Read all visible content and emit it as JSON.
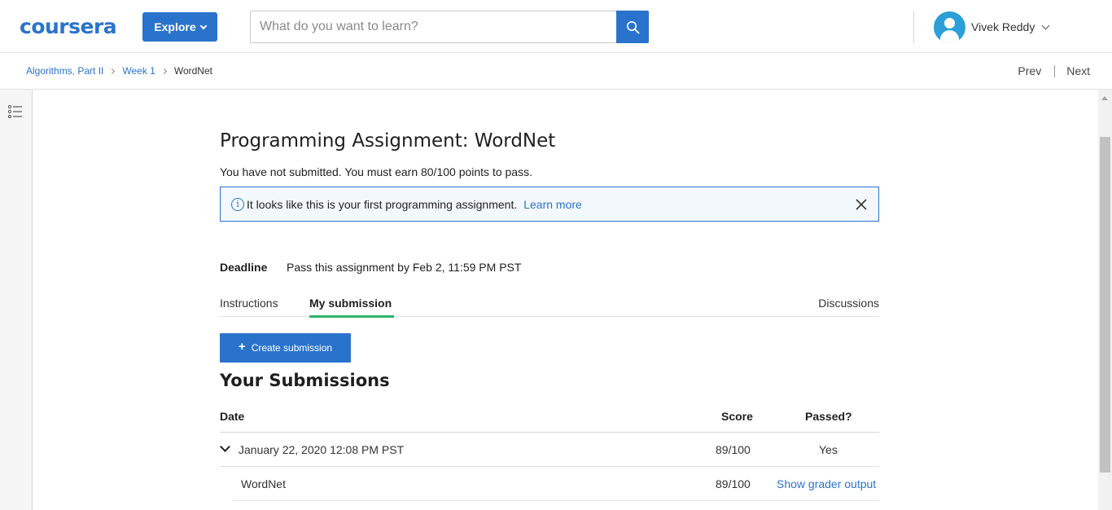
{
  "header": {
    "logo_text": "coursera",
    "explore_label": "Explore",
    "search_placeholder": "What do you want to learn?",
    "user_name": "Vivek Reddy"
  },
  "breadcrumb": {
    "items": [
      "Algorithms, Part II",
      "Week 1"
    ],
    "current": "WordNet",
    "prev_label": "Prev",
    "next_label": "Next"
  },
  "assignment": {
    "title": "Programming Assignment: WordNet",
    "status": "You have not submitted. You must earn 80/100 points to pass.",
    "banner_text": "It looks like this is your first programming assignment.",
    "banner_link": "Learn more",
    "deadline_label": "Deadline",
    "deadline_value": "Pass this assignment by Feb 2, 11:59 PM PST"
  },
  "tabs": {
    "instructions": "Instructions",
    "my_submission": "My submission",
    "discussions": "Discussions",
    "active": "my_submission"
  },
  "submissions": {
    "create_label": "Create submission",
    "section_title": "Your Submissions",
    "columns": {
      "date": "Date",
      "score": "Score",
      "passed": "Passed?"
    },
    "rows": [
      {
        "date": "January 22, 2020 12:08 PM PST",
        "score": "89/100",
        "passed": "Yes",
        "parts": [
          {
            "name": "WordNet",
            "score": "89/100",
            "link": "Show grader output"
          }
        ]
      }
    ]
  },
  "colors": {
    "brand_blue": "#2a73cc",
    "tab_underline": "#2fb56a",
    "avatar": "#2a9fd8"
  }
}
